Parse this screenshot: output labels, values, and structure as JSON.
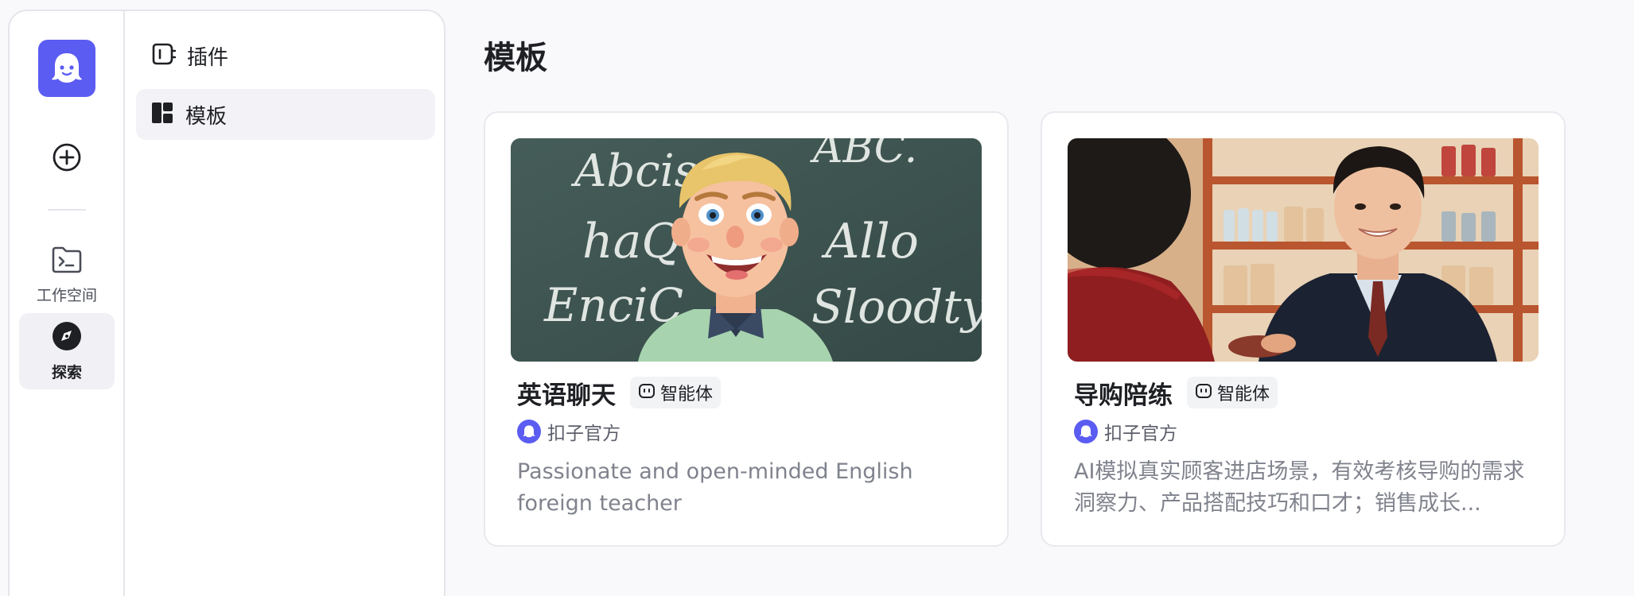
{
  "sidebar": {
    "logo_icon": "ghost-logo",
    "accent_color": "#5b5cf2",
    "add_icon": "plus-circle-icon",
    "items": [
      {
        "label": "工作空间",
        "icon": "terminal-folder-icon"
      },
      {
        "label": "探索",
        "icon": "compass-icon",
        "active": true
      }
    ]
  },
  "subnav": {
    "items": [
      {
        "label": "插件",
        "icon": "plug-icon"
      },
      {
        "label": "模板",
        "icon": "layout-grid-icon",
        "active": true
      }
    ]
  },
  "main": {
    "title": "模板",
    "cards": [
      {
        "title": "英语聊天",
        "tag": "智能体",
        "author": "扣子官方",
        "description": "Passionate and open-minded English foreign teacher",
        "image": "cartoon-teacher-at-chalkboard",
        "chalk_words": [
          "Abcise",
          "ABC.",
          "haQ",
          "Allo",
          "EnciC",
          "Sloodty"
        ]
      },
      {
        "title": "导购陪练",
        "tag": "智能体",
        "author": "扣子官方",
        "description": "AI模拟真实顾客进店场景，有效考核导购的需求洞察力、产品搭配技巧和口才；销售成长...",
        "image": "salesman-with-customer-in-store"
      }
    ]
  }
}
